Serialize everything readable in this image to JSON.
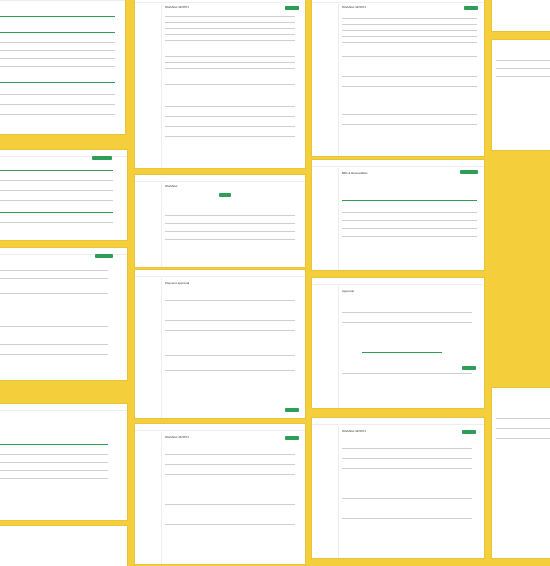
{
  "background": {
    "color": "#f5cf3b"
  },
  "accent": "#2e9d57",
  "sheets": [
    {
      "title": "Workflows",
      "subtitle": "Workflow 44/3671",
      "tag": "Draft",
      "button": "Save"
    },
    {
      "title": "Workflows",
      "subtitle": "Workflow 44/3671",
      "tag": "Active",
      "button": "Save"
    },
    {
      "title": "Workflows",
      "subtitle": "Workflow",
      "tag": "",
      "button": "Create"
    },
    {
      "title": "Workflows",
      "subtitle": "Bills & Receivables",
      "tag": "",
      "button": "Save"
    },
    {
      "title": "Approval",
      "subtitle": "Payment approval",
      "tag": "",
      "button": "Save"
    },
    {
      "title": "Workflows",
      "subtitle": "Workflow 44/3671",
      "tag": "Draft",
      "button": "Save"
    },
    {
      "title": "Workflows",
      "subtitle": "Workflow 44/3671",
      "tag": "Draft",
      "button": "Save"
    }
  ],
  "icons": {
    "green_dot": "status-icon"
  }
}
